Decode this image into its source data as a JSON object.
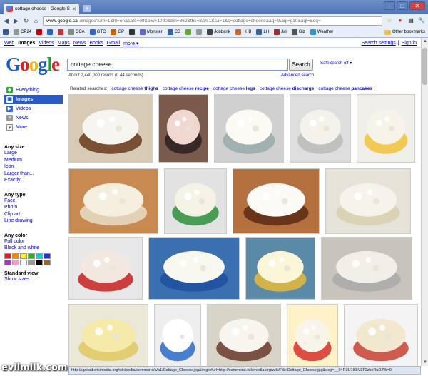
{
  "browser": {
    "tab_title": "cottage cheese - Google S...",
    "url_domain": "www.google.ca",
    "url_rest": "/images?um=1&hl=en&safe=off&biw=1090&bih=862&tbs=isch:1&sa=1&q=cottage+cheese&aq=f&aqi=g10&aql=&oq=",
    "bookmarks": [
      "CP24",
      "CCA",
      "GTC",
      "GP",
      "Monster",
      "CB",
      "Jobbank",
      "HHB",
      "LH",
      "Jal",
      "Giz",
      "Weather"
    ],
    "other_bookmarks": "Other bookmarks"
  },
  "gbar": {
    "links": [
      "Web",
      "Images",
      "Videos",
      "Maps",
      "News",
      "Books",
      "Gmail",
      "more"
    ],
    "current": "Images",
    "settings": "Search settings",
    "separator": "|",
    "signin": "Sign in"
  },
  "search": {
    "query": "cottage cheese",
    "button": "Search",
    "safesearch": "SafeSearch off ▾",
    "advanced": "Advanced search",
    "stats": "About 2,440,000 results (0.44 seconds)"
  },
  "sidebar": {
    "services": [
      {
        "label": "Everything",
        "icon": "everything-icon"
      },
      {
        "label": "Images",
        "icon": "images-icon"
      },
      {
        "label": "Videos",
        "icon": "videos-icon"
      },
      {
        "label": "News",
        "icon": "news-icon"
      },
      {
        "label": "More",
        "icon": "more-icon"
      }
    ],
    "size_title": "Any size",
    "sizes": [
      "Large",
      "Medium",
      "Icon",
      "Larger than...",
      "Exactly..."
    ],
    "type_title": "Any type",
    "types": [
      "Face",
      "Photo",
      "Clip art",
      "Line drawing"
    ],
    "color_title": "Any color",
    "colors_opts": [
      "Full color",
      "Black and white"
    ],
    "swatches": [
      "#d22",
      "#f80",
      "#fe3",
      "#3a3",
      "#2cc",
      "#23c",
      "#a3c",
      "#f9c",
      "#fff",
      "#999",
      "#000",
      "#963"
    ],
    "view_title": "Standard view",
    "view_opt": "Show sizes"
  },
  "related": {
    "label": "Related searches:",
    "prefix": "cottage cheese",
    "items": [
      "thighs",
      "recipe",
      "legs",
      "discharge",
      "pancakes"
    ]
  },
  "status": "http://upload.wikimedia.org/wikipedia/commons/a/a1/Cottage_Cheese.jpg&imgrefurl=http://commons.wikimedia.org/wiki/File:Cottage_Cheese.jpg&usg=__94R3U1l6kVLT0zhoRuD2W=0",
  "watermark": "evilmilk.com",
  "thumbs": [
    {
      "label": "bowl",
      "bg": "#d8cbb6",
      "fg": "#f7f5ef",
      "dark": "#6a3a1c"
    },
    {
      "label": "thighs",
      "bg": "#7a5a4a",
      "fg": "#f0d8d0",
      "dark": "#2a2020"
    },
    {
      "label": "glass bowl",
      "bg": "#d0d0d0",
      "fg": "#fbfaf3",
      "dark": "#9aa"
    },
    {
      "label": "bowl white",
      "bg": "#dedede",
      "fg": "#f4f2ea",
      "dark": "#bbb"
    },
    {
      "label": "peaches",
      "bg": "#f0efea",
      "fg": "#f6f3e8",
      "dark": "#f2c23a"
    },
    {
      "label": "cubes",
      "bg": "#c88a50",
      "fg": "#f5efe0",
      "dark": "#e8ddc8"
    },
    {
      "label": "green bowl",
      "bg": "#e2e2e2",
      "fg": "#f5f2e6",
      "dark": "#2d8f3a"
    },
    {
      "label": "pot",
      "bg": "#b57040",
      "fg": "#fbfaf5",
      "dark": "#5a2a14"
    },
    {
      "label": "glass eggs",
      "bg": "#e6e3d8",
      "fg": "#f6f4ea",
      "dark": "#d8d0b0"
    },
    {
      "label": "containers",
      "bg": "#e8e8e8",
      "fg": "#f2e8e0",
      "dark": "#c82020"
    },
    {
      "label": "blue bowl",
      "bg": "#3a6fb0",
      "fg": "#f8f7f0",
      "dark": "#2050a0"
    },
    {
      "label": "parfait",
      "bg": "#5a8aa8",
      "fg": "#fbf6d8",
      "dark": "#e8b83a"
    },
    {
      "label": "plain bowl",
      "bg": "#c8c4bc",
      "fg": "#f2efe6",
      "dark": "#aaa"
    },
    {
      "label": "curds",
      "bg": "#ece8d8",
      "fg": "#f6eaa8",
      "dark": "#e0c860"
    },
    {
      "label": "hood",
      "bg": "#eeeeee",
      "fg": "#ffffff",
      "dark": "#2a6ac8"
    },
    {
      "label": "granola",
      "bg": "#d8d4c8",
      "fg": "#f7f5ee",
      "dark": "#6a3a2a"
    },
    {
      "label": "strawberry",
      "bg": "#fff2c8",
      "fg": "#f8f4ea",
      "dark": "#d8302a"
    },
    {
      "label": "cups",
      "bg": "#f4f4f4",
      "fg": "#f2e8d0",
      "dark": "#c84030"
    }
  ]
}
